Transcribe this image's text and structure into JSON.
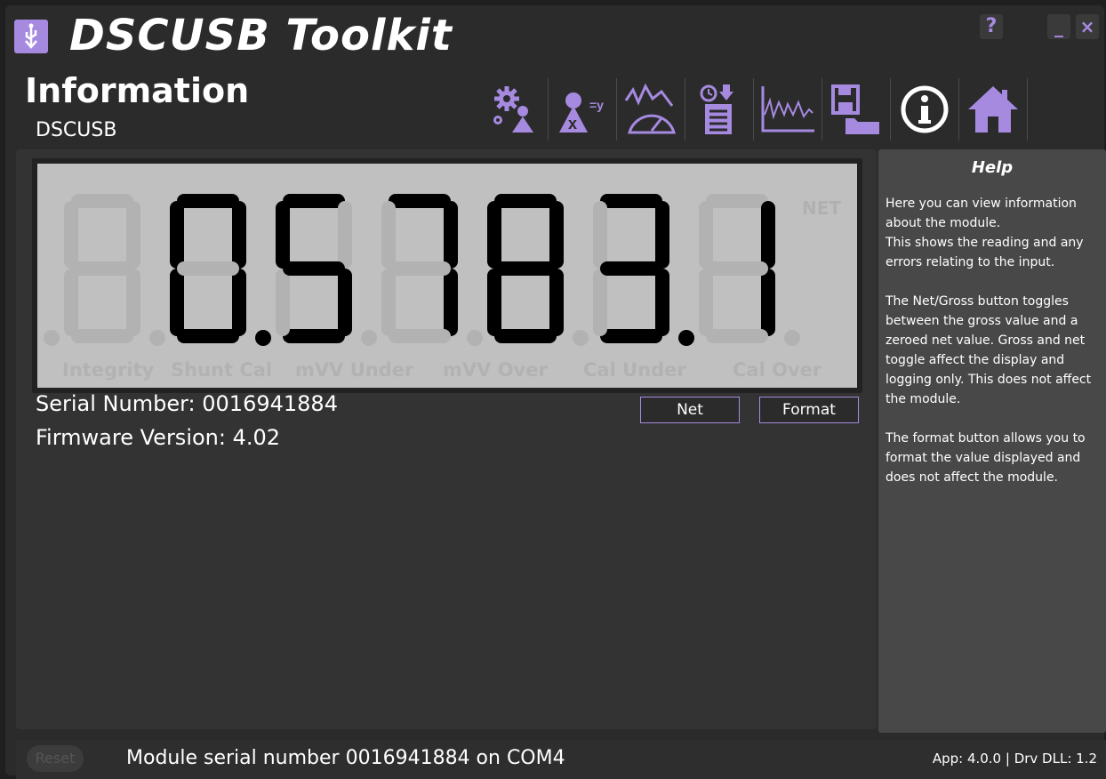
{
  "window": {
    "title": "DSCUSB Toolkit",
    "help_label": "?",
    "minimize_label": "_",
    "close_label": "×"
  },
  "header": {
    "title": "Information",
    "subtitle": "DSCUSB"
  },
  "toolbar": {
    "tools": [
      "settings-icon",
      "calculate-icon",
      "gauge-icon",
      "datalog-icon",
      "chart-icon",
      "save-load-icon",
      "info-icon",
      "home-icon"
    ]
  },
  "display": {
    "reading": "0.5783.1",
    "net_indicator": "NET",
    "flags": [
      "Integrity",
      "Shunt Cal",
      "mVV Under",
      "mVV Over",
      "Cal Under",
      "Cal Over"
    ]
  },
  "info": {
    "serial_label": "Serial Number:",
    "serial_value": "0016941884",
    "firmware_label": "Firmware Version:",
    "firmware_value": "4.02"
  },
  "buttons": {
    "net": "Net",
    "format": "Format"
  },
  "help": {
    "title": "Help",
    "text": "Here you can view information about the module.\nThis shows the reading and any errors relating to the input.\n\nThe Net/Gross button toggles between the gross value and a zeroed net value. Gross and net toggle affect the display and logging only. This does not affect the module.\n\nThe format button allows you to format the value displayed and does not affect the module."
  },
  "status": {
    "reset": "Reset",
    "message": "Module serial number 0016941884 on COM4",
    "version": "App: 4.0.0 | Drv DLL: 1.2"
  },
  "colors": {
    "accent": "#a68ae0",
    "background": "#2b2b2b",
    "lcd": "#c0c0c0",
    "segment_on": "#000000",
    "segment_off": "#b2b2b2"
  }
}
